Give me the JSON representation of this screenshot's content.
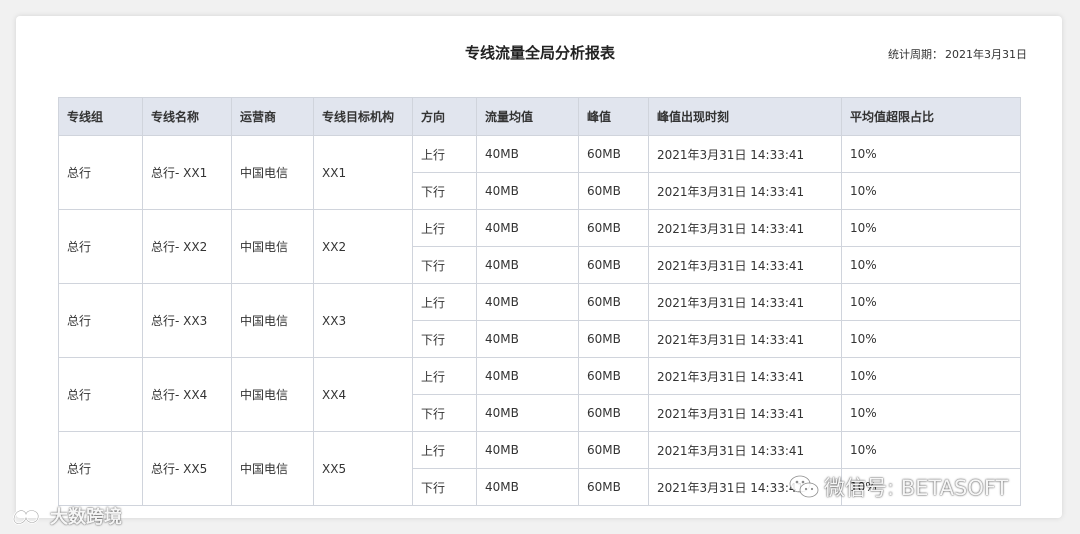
{
  "report": {
    "title": "专线流量全局分析报表",
    "period_label": "统计周期：",
    "period_value": "2021年3月31日"
  },
  "table": {
    "headers": [
      "专线组",
      "专线名称",
      "运营商",
      "专线目标机构",
      "方向",
      "流量均值",
      "峰值",
      "峰值出现时刻",
      "平均值超限占比"
    ],
    "groups": [
      {
        "group": "总行",
        "name": "总行- XX1",
        "carrier": "中国电信",
        "target": "XX1",
        "rows": [
          {
            "dir": "上行",
            "avg": "40MB",
            "peak": "60MB",
            "time": "2021年3月31日 14:33:41",
            "ratio": "10%"
          },
          {
            "dir": "下行",
            "avg": "40MB",
            "peak": "60MB",
            "time": "2021年3月31日 14:33:41",
            "ratio": "10%"
          }
        ]
      },
      {
        "group": "总行",
        "name": "总行- XX2",
        "carrier": "中国电信",
        "target": "XX2",
        "rows": [
          {
            "dir": "上行",
            "avg": "40MB",
            "peak": "60MB",
            "time": "2021年3月31日 14:33:41",
            "ratio": "10%"
          },
          {
            "dir": "下行",
            "avg": "40MB",
            "peak": "60MB",
            "time": "2021年3月31日 14:33:41",
            "ratio": "10%"
          }
        ]
      },
      {
        "group": "总行",
        "name": "总行- XX3",
        "carrier": "中国电信",
        "target": "XX3",
        "rows": [
          {
            "dir": "上行",
            "avg": "40MB",
            "peak": "60MB",
            "time": "2021年3月31日 14:33:41",
            "ratio": "10%"
          },
          {
            "dir": "下行",
            "avg": "40MB",
            "peak": "60MB",
            "time": "2021年3月31日 14:33:41",
            "ratio": "10%"
          }
        ]
      },
      {
        "group": "总行",
        "name": "总行- XX4",
        "carrier": "中国电信",
        "target": "XX4",
        "rows": [
          {
            "dir": "上行",
            "avg": "40MB",
            "peak": "60MB",
            "time": "2021年3月31日 14:33:41",
            "ratio": "10%"
          },
          {
            "dir": "下行",
            "avg": "40MB",
            "peak": "60MB",
            "time": "2021年3月31日 14:33:41",
            "ratio": "10%"
          }
        ]
      },
      {
        "group": "总行",
        "name": "总行- XX5",
        "carrier": "中国电信",
        "target": "XX5",
        "rows": [
          {
            "dir": "上行",
            "avg": "40MB",
            "peak": "60MB",
            "time": "2021年3月31日 14:33:41",
            "ratio": "10%"
          },
          {
            "dir": "下行",
            "avg": "40MB",
            "peak": "60MB",
            "time": "2021年3月31日 14:33:41",
            "ratio": "10%"
          }
        ]
      }
    ]
  },
  "watermarks": {
    "left_text": "大数跨境",
    "right_text": "微信号: BETASOFT",
    "icons": [
      "brand-logo-icon",
      "wechat-icon"
    ]
  },
  "colors": {
    "header_bg": "#e1e5ee",
    "border": "#d0d4dc",
    "page_bg": "#f1f1f1"
  }
}
